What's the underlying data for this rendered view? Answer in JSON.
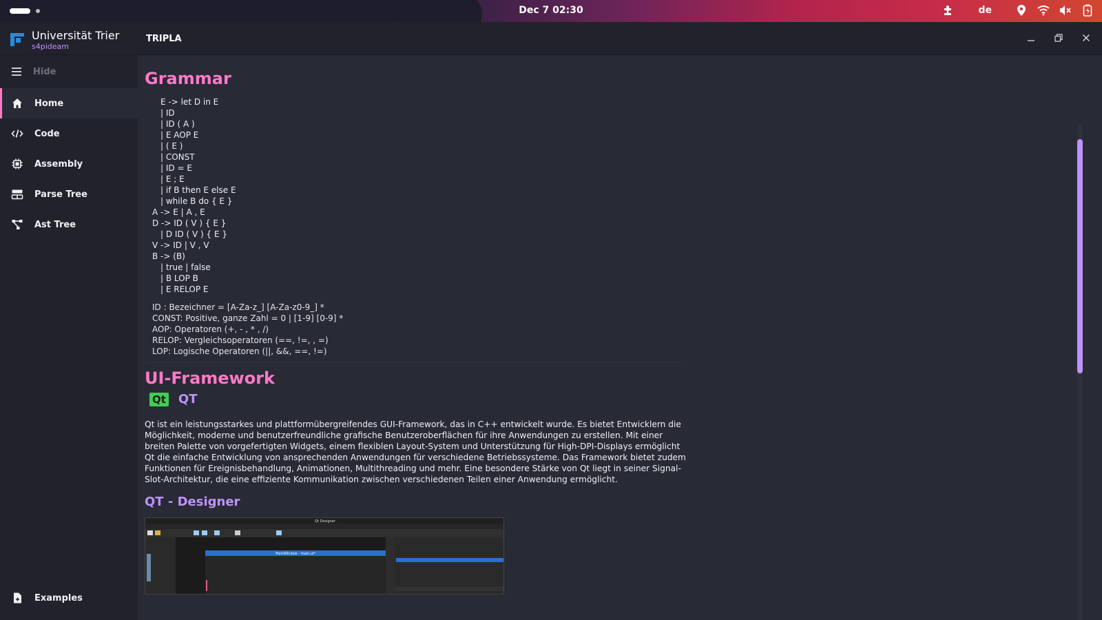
{
  "system": {
    "clock": "Dec 7  02:30",
    "language": "de"
  },
  "window": {
    "brand_name": "Universität Trier",
    "brand_user": "s4pideam",
    "title": "TRIPLA"
  },
  "sidebar": {
    "hide_label": "Hide",
    "items": [
      {
        "label": "Home",
        "icon": "home-icon",
        "active": true
      },
      {
        "label": "Code",
        "icon": "code-icon"
      },
      {
        "label": "Assembly",
        "icon": "chip-icon"
      },
      {
        "label": "Parse Tree",
        "icon": "table-icon"
      },
      {
        "label": "Ast Tree",
        "icon": "tree-icon"
      }
    ],
    "examples_label": "Examples"
  },
  "grammar": {
    "heading": "Grammar",
    "lines": [
      {
        "indent": 2,
        "text": "E -> let D in E"
      },
      {
        "indent": 2,
        "text": "| ID"
      },
      {
        "indent": 2,
        "text": "| ID ( A )"
      },
      {
        "indent": 2,
        "text": "| E AOP E"
      },
      {
        "indent": 2,
        "text": "| ( E )"
      },
      {
        "indent": 2,
        "text": "| CONST"
      },
      {
        "indent": 2,
        "text": "| ID = E"
      },
      {
        "indent": 2,
        "text": "| E ; E"
      },
      {
        "indent": 2,
        "text": "| if B then E else E"
      },
      {
        "indent": 2,
        "text": "| while B do { E }"
      },
      {
        "indent": 1,
        "text": "A -> E | A , E"
      },
      {
        "indent": 1,
        "text": "D -> ID ( V ) { E }"
      },
      {
        "indent": 2,
        "text": "| D ID ( V ) { E }"
      },
      {
        "indent": 1,
        "text": "V -> ID | V , V"
      },
      {
        "indent": 1,
        "text": "B -> (B)"
      },
      {
        "indent": 2,
        "text": "| true | false"
      },
      {
        "indent": 2,
        "text": "| B LOP B"
      },
      {
        "indent": 2,
        "text": "| E RELOP E"
      }
    ],
    "definitions": [
      "ID : Bezeichner = [A-Za-z_] [A-Za-z0-9_] *",
      "CONST: Positive, ganze Zahl = 0 | [1-9] [0-9] *",
      "AOP: Operatoren (+, - , * , /)",
      "RELOP: Vergleichsoperatoren (==, !=, , =)",
      "LOP: Logische Operatoren (||, &&, ==, !=)"
    ]
  },
  "framework": {
    "heading": "UI-Framework",
    "logo_text": "Qt",
    "name": "QT",
    "description": "Qt ist ein leistungsstarkes und plattformübergreifendes GUI-Framework, das in C++ entwickelt wurde. Es bietet Entwicklern die Möglichkeit, moderne und benutzerfreundliche grafische Benutzeroberflächen für ihre Anwendungen zu erstellen. Mit einer breiten Palette von vorgefertigten Widgets, einem flexiblen Layout-System und Unterstützung für High-DPI-Displays ermöglicht Qt die einfache Entwicklung von ansprechenden Anwendungen für verschiedene Betriebssysteme. Das Framework bietet zudem Funktionen für Ereignisbehandlung, Animationen, Multithreading und mehr. Eine besondere Stärke von Qt liegt in seiner Signal-Slot-Architektur, die eine effiziente Kommunikation zwischen verschiedenen Teilen einer Anwendung ermöglicht.",
    "designer_heading": "QT - Designer",
    "designer_window_title": "Qt Designer",
    "designer_inner_title": "MainWindow - main.ui*"
  },
  "colors": {
    "accent_pink": "#ff79c6",
    "accent_purple": "#bd93f9",
    "qt_green": "#41cd52",
    "background": "#282a36",
    "sidebar": "#21222c"
  }
}
